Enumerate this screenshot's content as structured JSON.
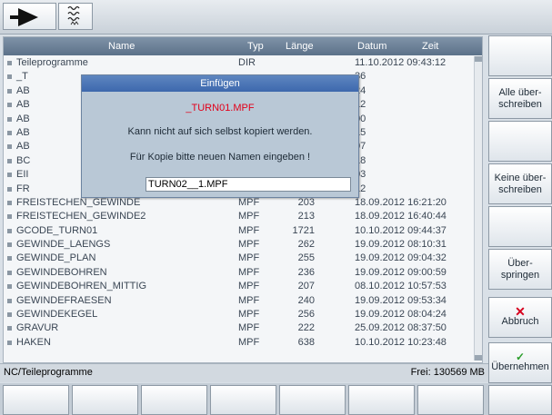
{
  "list": {
    "headers": {
      "name": "Name",
      "type": "Typ",
      "length": "Länge",
      "date": "Datum",
      "time": "Zeit"
    },
    "rows": [
      {
        "name": "Teileprogramme",
        "type": "DIR",
        "length": "",
        "datetime": "11.10.2012 09:43:12"
      },
      {
        "name": "_T",
        "type": "",
        "length": "",
        "datetime": "36"
      },
      {
        "name": "AB",
        "type": "",
        "length": "",
        "datetime": "24"
      },
      {
        "name": "AB",
        "type": "",
        "length": "",
        "datetime": "12"
      },
      {
        "name": "AB",
        "type": "",
        "length": "",
        "datetime": "00"
      },
      {
        "name": "AB",
        "type": "",
        "length": "",
        "datetime": "15"
      },
      {
        "name": "AB",
        "type": "",
        "length": "",
        "datetime": "07"
      },
      {
        "name": "BC",
        "type": "",
        "length": "",
        "datetime": "18"
      },
      {
        "name": "EII",
        "type": "",
        "length": "",
        "datetime": "03"
      },
      {
        "name": "FR",
        "type": "",
        "length": "",
        "datetime": "12"
      },
      {
        "name": "FREISTECHEN_GEWINDE",
        "type": "MPF",
        "length": "203",
        "datetime": "18.09.2012 16:21:20"
      },
      {
        "name": "FREISTECHEN_GEWINDE2",
        "type": "MPF",
        "length": "213",
        "datetime": "18.09.2012 16:40:44"
      },
      {
        "name": "GCODE_TURN01",
        "type": "MPF",
        "length": "1721",
        "datetime": "10.10.2012 09:44:37"
      },
      {
        "name": "GEWINDE_LAENGS",
        "type": "MPF",
        "length": "262",
        "datetime": "19.09.2012 08:10:31"
      },
      {
        "name": "GEWINDE_PLAN",
        "type": "MPF",
        "length": "255",
        "datetime": "19.09.2012 09:04:32"
      },
      {
        "name": "GEWINDEBOHREN",
        "type": "MPF",
        "length": "236",
        "datetime": "19.09.2012 09:00:59"
      },
      {
        "name": "GEWINDEBOHREN_MITTIG",
        "type": "MPF",
        "length": "207",
        "datetime": "08.10.2012 10:57:53"
      },
      {
        "name": "GEWINDEFRAESEN",
        "type": "MPF",
        "length": "240",
        "datetime": "19.09.2012 09:53:34"
      },
      {
        "name": "GEWINDEKEGEL",
        "type": "MPF",
        "length": "256",
        "datetime": "19.09.2012 08:04:24"
      },
      {
        "name": "GRAVUR",
        "type": "MPF",
        "length": "222",
        "datetime": "25.09.2012 08:37:50"
      },
      {
        "name": "HAKEN",
        "type": "MPF",
        "length": "638",
        "datetime": "10.10.2012 10:23:48"
      }
    ]
  },
  "dialog": {
    "title": "Einfügen",
    "filename": "_TURN01.MPF",
    "message": "Kann nicht auf sich selbst kopiert werden.",
    "prompt": "Für Kopie bitte neuen Namen eingeben !",
    "input_value": "TURN02__1.MPF"
  },
  "status": {
    "path": "NC/Teileprogramme",
    "free": "Frei: 130569 MB"
  },
  "softkeys": {
    "alle": "Alle über-\nschreiben",
    "keine": "Keine über-\nschreiben",
    "ueberspringen": "Über-\nspringen",
    "abbruch": "Abbruch",
    "uebernehmen": "Übernehmen"
  },
  "icons": {
    "mode": "machine-area-arrow-icon",
    "wave": "wave-icon",
    "cancel": "red-x-icon",
    "accept": "green-check-icon"
  },
  "colors": {
    "dialog_title_bg": "#3d68ad",
    "dialog_filename": "#e2001a",
    "list_header_bg": "#5c7189"
  }
}
